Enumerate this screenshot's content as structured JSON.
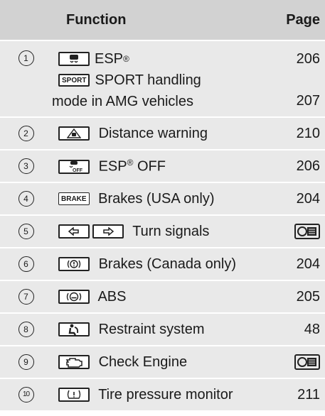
{
  "header": {
    "function": "Function",
    "page": "Page"
  },
  "rows": [
    {
      "num": "1",
      "lines": [
        {
          "icon": "esp-icon",
          "label": "ESP",
          "sup": "®"
        },
        {
          "icon_text": "SPORT",
          "label": "SPORT handling"
        },
        {
          "label": "mode in AMG vehicles"
        }
      ],
      "pages": [
        "206",
        "207"
      ]
    },
    {
      "num": "2",
      "icon": "distance-warning-icon",
      "label": "Distance warning",
      "page": "210"
    },
    {
      "num": "3",
      "icon": "esp-off-icon",
      "label": "ESP",
      "sup": "®",
      "label2": " OFF",
      "page": "206"
    },
    {
      "num": "4",
      "icon_text": "BRAKE",
      "label": "Brakes (USA only)",
      "page": "204"
    },
    {
      "num": "5",
      "icon": "turn-signal-icons",
      "label": "Turn signals",
      "page_icon": "manual-icon"
    },
    {
      "num": "6",
      "icon": "brake-canada-icon",
      "label": "Brakes (Canada only)",
      "page": "204"
    },
    {
      "num": "7",
      "icon": "abs-icon",
      "label": "ABS",
      "page": "205"
    },
    {
      "num": "8",
      "icon": "restraint-icon",
      "label": "Restraint system",
      "page": "48"
    },
    {
      "num": "9",
      "icon": "check-engine-icon",
      "label": "Check Engine",
      "page_icon": "manual-icon"
    },
    {
      "num": "10",
      "icon": "tire-pressure-icon",
      "label": "Tire pressure monitor",
      "page": "211"
    }
  ]
}
